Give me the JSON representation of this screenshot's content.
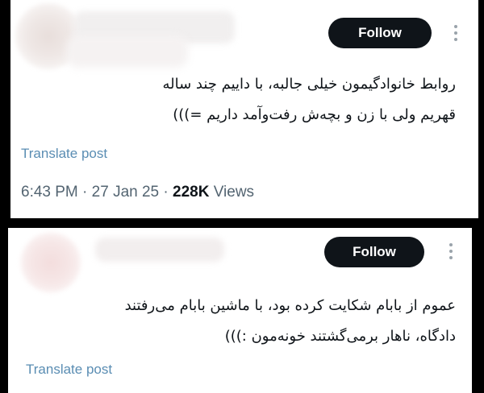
{
  "tweets": [
    {
      "follow_label": "Follow",
      "text_lines": [
        "روابط خانوادگیمون خیلی جالبه، با داییم چند ساله",
        "قهریم ولی با زن و بچه‌ش رفت‌وآمد داریم =)))"
      ],
      "translate_label": "Translate post",
      "time": "6:43 PM",
      "separator": "·",
      "date": "27 Jan 25",
      "views_count": "228K",
      "views_label": "Views"
    },
    {
      "follow_label": "Follow",
      "text_lines": [
        "عموم از بابام شکایت کرده بود، با ماشین بابام می‌رفتند",
        "دادگاه، ناهار برمی‌گشتند خونه‌مون :)))"
      ],
      "translate_label": "Translate post"
    }
  ],
  "colors": {
    "background": "#000000",
    "card": "#ffffff",
    "follow_button": "#0f1419",
    "link": "#5a8db3",
    "meta": "#536471"
  },
  "icons": [
    "more-vertical-icon"
  ]
}
